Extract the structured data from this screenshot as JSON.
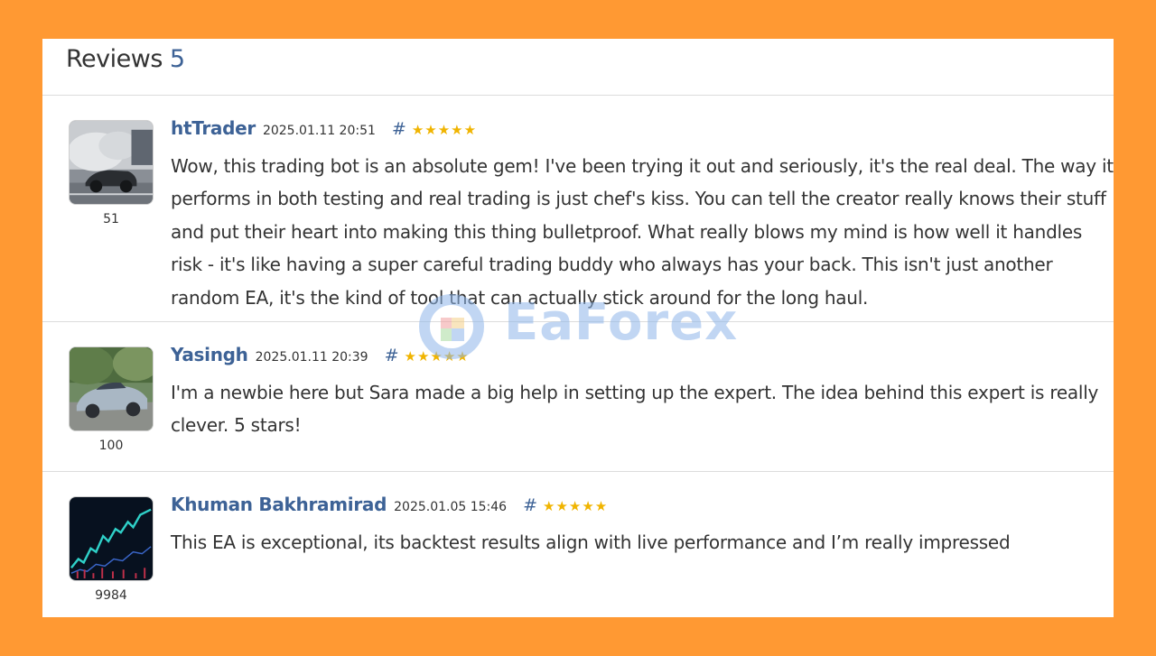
{
  "header": {
    "title": "Reviews",
    "count": "5"
  },
  "watermark": {
    "text": "EaForex"
  },
  "colors": {
    "page_background": "#FF9933",
    "author_link": "#3d6296",
    "stars": "#f0b400"
  },
  "reviews": [
    {
      "author": "htTrader",
      "date": "2025.01.11 20:51",
      "hash": "#",
      "stars": "★★★★★",
      "rating_number": "51",
      "avatar_icon": "car-drift-photo",
      "text": "Wow, this trading bot is an absolute gem! I've been trying it out and seriously, it's the real deal. The way it performs in both testing and real trading is just chef's kiss. You can tell the creator really knows their stuff and put their heart into making this thing bulletproof. What really blows my mind is how well it handles risk - it's like having a super careful trading buddy who always has your back. This isn't just another random EA, it's the kind of tool that can actually stick around for the long haul."
    },
    {
      "author": "Yasingh",
      "date": "2025.01.11 20:39",
      "hash": "#",
      "stars": "★★★★★",
      "rating_number": "100",
      "avatar_icon": "sports-car-photo",
      "text": "I'm a newbie here but Sara made a big help in setting up the expert. The idea behind this expert is really clever. 5 stars!"
    },
    {
      "author": "Khuman Bakhramirad",
      "date": "2025.01.05 15:46",
      "hash": "#",
      "stars": "★★★★★",
      "rating_number": "9984",
      "avatar_icon": "candlestick-chart-photo",
      "text": "This EA is exceptional, its backtest results align with live performance and I’m really impressed"
    }
  ]
}
